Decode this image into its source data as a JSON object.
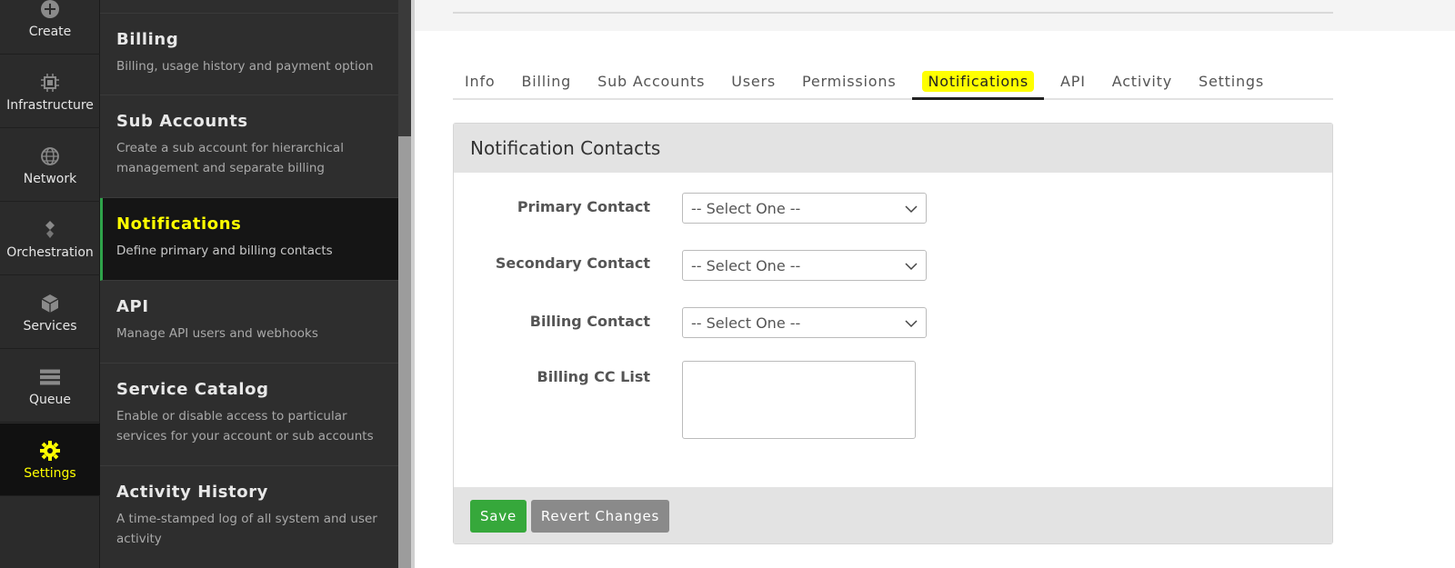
{
  "rail": [
    {
      "id": "create",
      "label": "Create",
      "icon": "plus-circle-icon",
      "active": false
    },
    {
      "id": "infrastructure",
      "label": "Infrastructure",
      "icon": "chip-icon",
      "active": false
    },
    {
      "id": "network",
      "label": "Network",
      "icon": "globe-icon",
      "active": false
    },
    {
      "id": "orchestration",
      "label": "Orchestration",
      "icon": "orchestration-icon",
      "active": false
    },
    {
      "id": "services",
      "label": "Services",
      "icon": "cube-icon",
      "active": false
    },
    {
      "id": "queue",
      "label": "Queue",
      "icon": "server-stack-icon",
      "active": false
    },
    {
      "id": "settings",
      "label": "Settings",
      "icon": "gear-icon",
      "active": true
    }
  ],
  "menu": [
    {
      "title": "Billing",
      "desc": "Billing, usage history and payment option"
    },
    {
      "title": "Sub Accounts",
      "desc": "Create a sub account for hierarchical management and separate billing"
    },
    {
      "title": "Notifications",
      "desc": "Define primary and billing contacts",
      "active": true
    },
    {
      "title": "API",
      "desc": "Manage API users and webhooks"
    },
    {
      "title": "Service Catalog",
      "desc": "Enable or disable access to particular services for your account or sub accounts"
    },
    {
      "title": "Activity History",
      "desc": "A time-stamped log of all system and user activity"
    }
  ],
  "tabs": [
    "Info",
    "Billing",
    "Sub Accounts",
    "Users",
    "Permissions",
    "Notifications",
    "API",
    "Activity",
    "Settings"
  ],
  "active_tab": "Notifications",
  "panel": {
    "title": "Notification Contacts",
    "primary_label": "Primary Contact",
    "primary_value": "-- Select One --",
    "secondary_label": "Secondary Contact",
    "secondary_value": "-- Select One --",
    "billing_label": "Billing Contact",
    "billing_value": "-- Select One --",
    "cc_label": "Billing CC List",
    "cc_value": ""
  },
  "actions": {
    "save": "Save",
    "revert": "Revert Changes"
  },
  "colors": {
    "accent_green": "#36a83b",
    "highlight": "#ffff00",
    "rail_bg": "#2b2b2b",
    "menu_bg": "#2e2e2e"
  }
}
